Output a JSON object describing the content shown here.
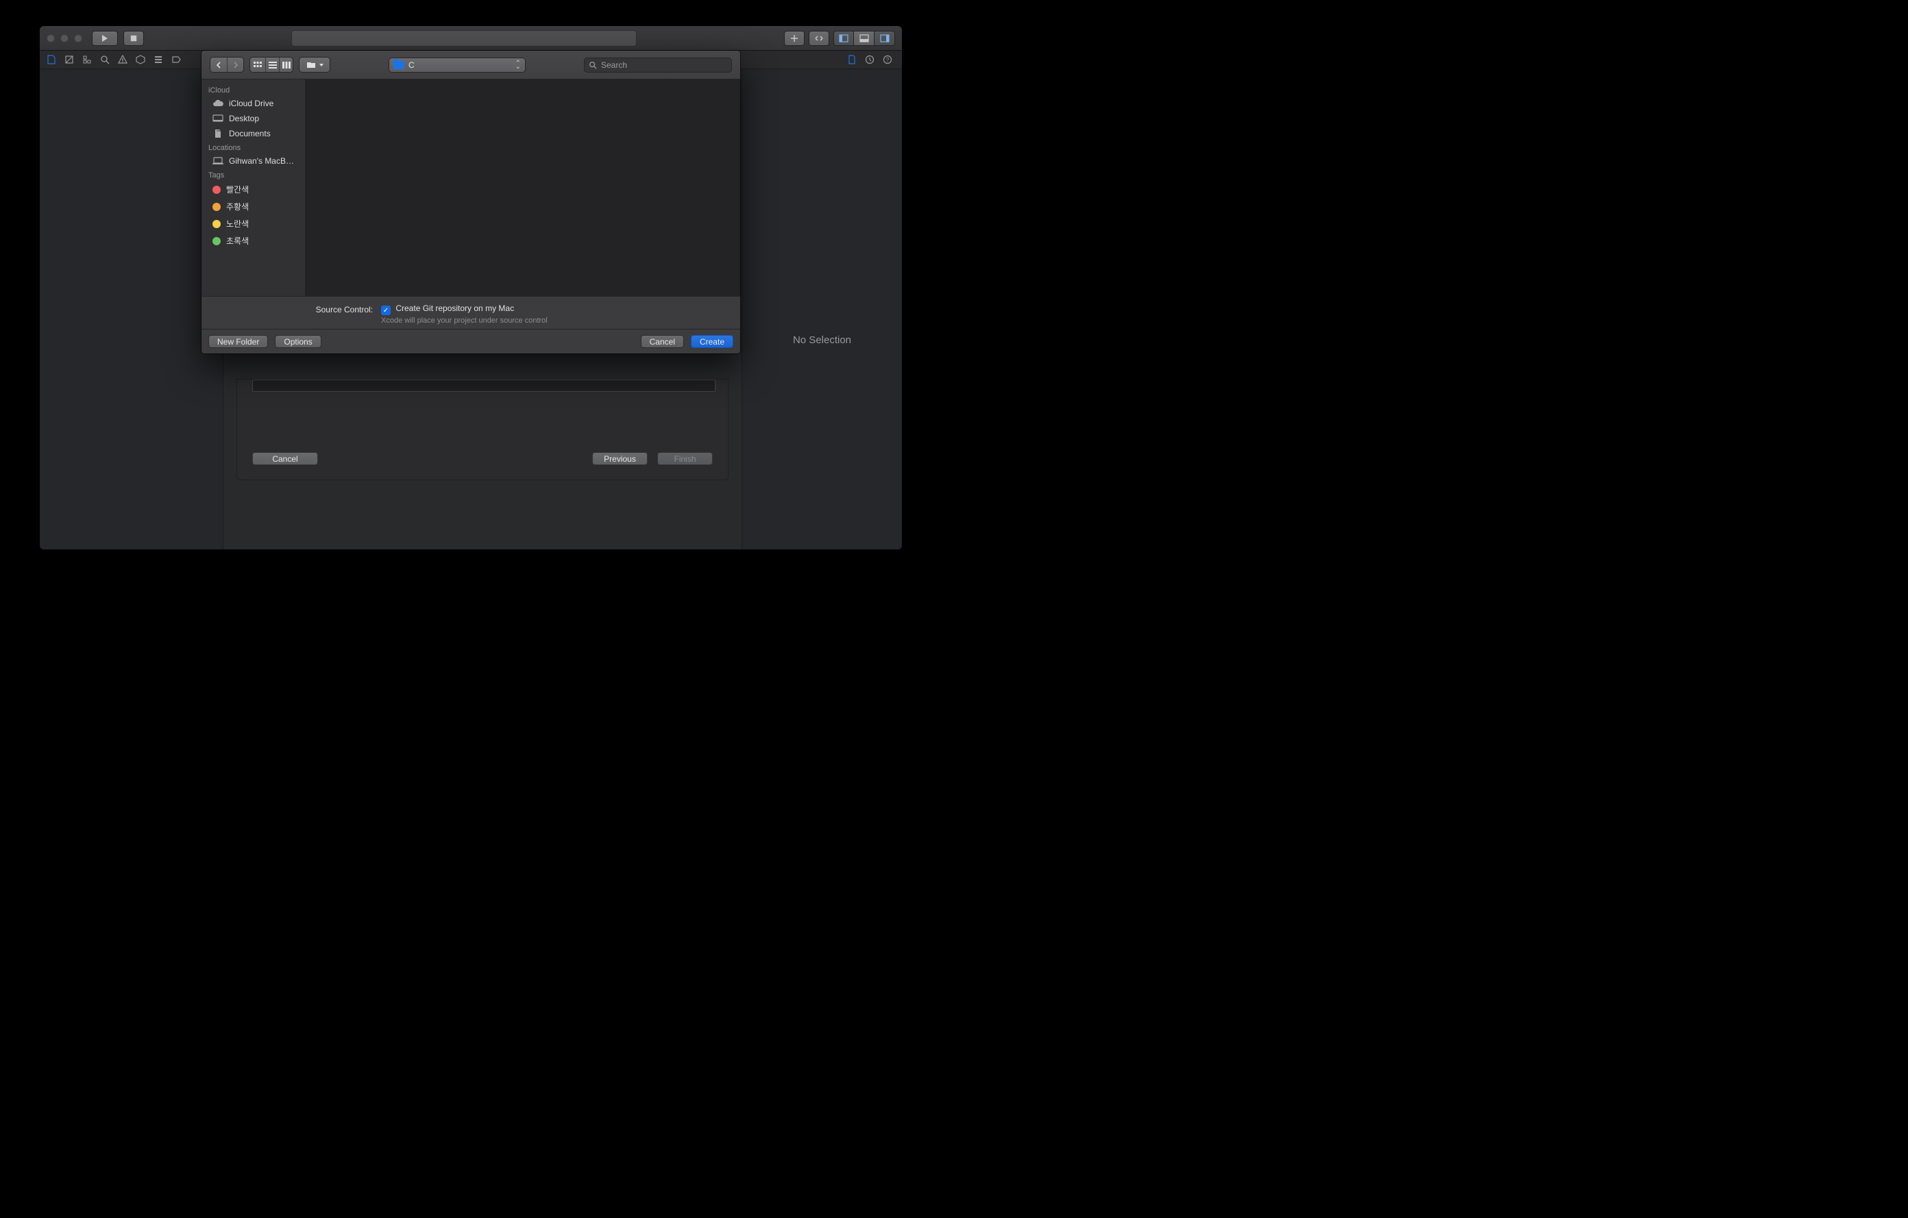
{
  "inspector": {
    "no_selection": "No Selection"
  },
  "wizard": {
    "cancel": "Cancel",
    "previous": "Previous",
    "finish": "Finish"
  },
  "save_panel": {
    "path_label": "C",
    "search_placeholder": "Search",
    "sidebar": {
      "groups": [
        {
          "title": "iCloud",
          "items": [
            {
              "icon": "cloud",
              "label": "iCloud Drive"
            },
            {
              "icon": "desktop",
              "label": "Desktop"
            },
            {
              "icon": "documents",
              "label": "Documents"
            }
          ]
        },
        {
          "title": "Locations",
          "items": [
            {
              "icon": "laptop",
              "label": "Gihwan's MacB…"
            }
          ]
        },
        {
          "title": "Tags",
          "items": [
            {
              "icon": "tag",
              "color": "#ec5f5e",
              "label": "빨간색"
            },
            {
              "icon": "tag",
              "color": "#f1a33b",
              "label": "주황색"
            },
            {
              "icon": "tag",
              "color": "#f6cf48",
              "label": "노란색"
            },
            {
              "icon": "tag",
              "color": "#68c662",
              "label": "초록색"
            }
          ]
        }
      ]
    },
    "option_label": "Source Control:",
    "option_checkbox": "Create Git repository on my Mac",
    "option_hint": "Xcode will place your project under source control",
    "buttons": {
      "new_folder": "New Folder",
      "options": "Options",
      "cancel": "Cancel",
      "create": "Create"
    }
  }
}
